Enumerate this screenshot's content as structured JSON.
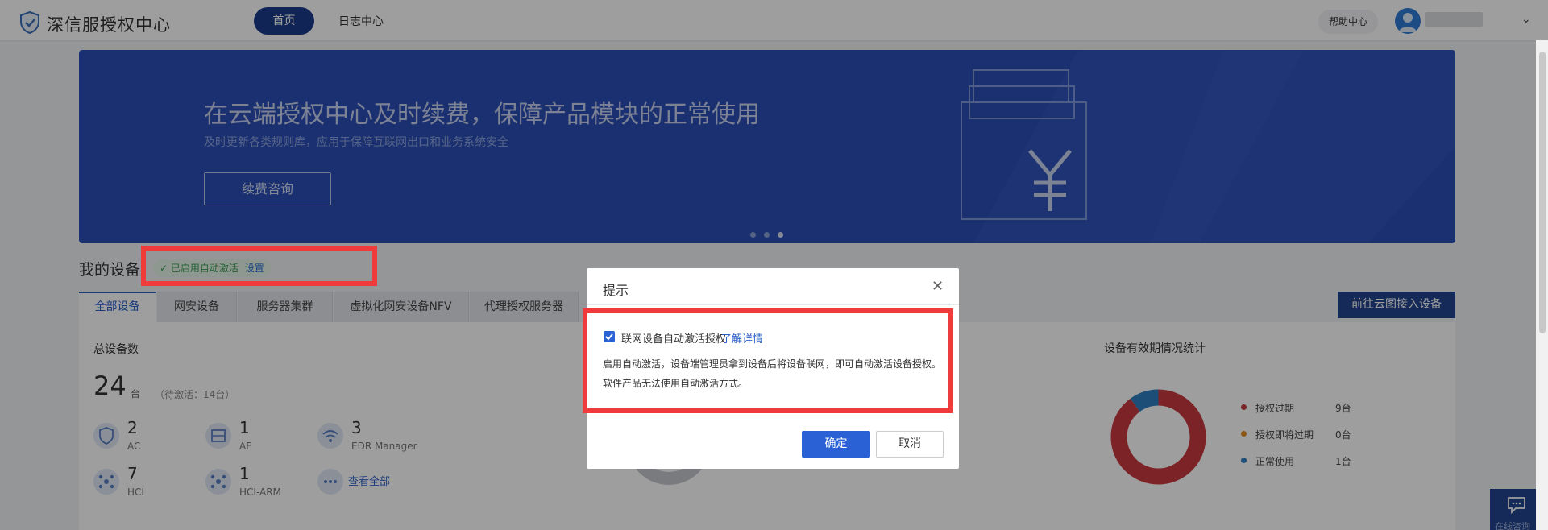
{
  "app": {
    "title": "深信服授权中心",
    "logo_icon": "shield-logo-icon"
  },
  "nav": {
    "home": "首页",
    "log": "日志中心"
  },
  "header": {
    "help": "帮助中心",
    "avatar_icon": "user-avatar-icon",
    "dropdown_icon": "chevron-down-icon"
  },
  "banner": {
    "title": "在云端授权中心及时续费，保障产品模块的正常使用",
    "subtitle": "及时更新各类规则库，应用于保障互联网出口和业务系统安全",
    "button": "续费咨询",
    "active_slide": 3,
    "slide_count": 3
  },
  "devices": {
    "title": "我的设备",
    "auto_status": "已启用自动激活",
    "auto_setting": "设置",
    "tabs": [
      {
        "label": "全部设备",
        "active": true
      },
      {
        "label": "网安设备",
        "active": false
      },
      {
        "label": "服务器集群",
        "active": false
      },
      {
        "label": "虚拟化网安设备NFV",
        "active": false
      },
      {
        "label": "代理授权服务器",
        "active": false
      }
    ],
    "cloud_button": "前往云图接入设备",
    "total_label": "总设备数",
    "total_count": "24",
    "total_unit": "台",
    "pending": "（待激活：14台）",
    "items": [
      {
        "count": "2",
        "name": "AC"
      },
      {
        "count": "1",
        "name": "AF"
      },
      {
        "count": "3",
        "name": "EDR Manager"
      },
      {
        "count": "7",
        "name": "HCI"
      },
      {
        "count": "1",
        "name": "HCI-ARM"
      }
    ],
    "view_all": "查看全部"
  },
  "validity": {
    "title": "设备有效期情况统计",
    "legend": [
      {
        "label": "授权过期",
        "value": "9台",
        "color": "#c9393f"
      },
      {
        "label": "授权即将过期",
        "value": "0台",
        "color": "#e08a1e"
      },
      {
        "label": "正常使用",
        "value": "1台",
        "color": "#2f7fc1"
      }
    ],
    "chart_data": {
      "type": "pie",
      "categories": [
        "授权过期",
        "授权即将过期",
        "正常使用"
      ],
      "values": [
        9,
        0,
        1
      ]
    }
  },
  "chat": {
    "label": "在线咨询"
  },
  "dialog": {
    "title": "提示",
    "checkbox_label": "联网设备自动激活授权",
    "checkbox_checked": true,
    "link": "了解详情",
    "desc1": "启用自动激活，设备端管理员拿到设备后将设备联网，即可自动激活设备授权。",
    "desc2": "软件产品无法使用自动激活方式。",
    "ok": "确定",
    "cancel": "取消"
  },
  "colors": {
    "primary": "#2a62d6",
    "nav_active": "#1b3c8c",
    "banner": "#2a4eb6",
    "highlight": "#ef3b3b"
  }
}
